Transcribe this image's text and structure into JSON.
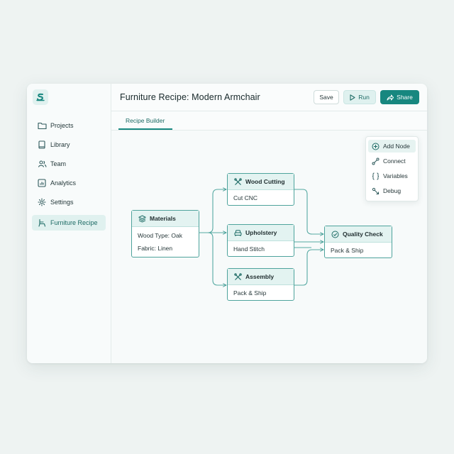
{
  "app": {
    "title": "Furniture Recipe: Modern Armchair"
  },
  "sidebar": {
    "items": [
      {
        "label": "Projects",
        "icon": "folder-icon"
      },
      {
        "label": "Library",
        "icon": "book-icon"
      },
      {
        "label": "Team",
        "icon": "team-icon"
      },
      {
        "label": "Analytics",
        "icon": "chart-icon"
      },
      {
        "label": "Settings",
        "icon": "gear-icon"
      },
      {
        "label": "Furniture Recipe",
        "icon": "chair-icon",
        "active": true
      }
    ]
  },
  "toolbar": {
    "save_label": "Save",
    "run_label": "Run",
    "share_label": "Share"
  },
  "tabs": [
    {
      "label": "Recipe Builder",
      "active": true
    }
  ],
  "menu": {
    "items": [
      {
        "label": "Add Node",
        "icon": "plus-circle-icon"
      },
      {
        "label": "Connect",
        "icon": "link-icon"
      },
      {
        "label": "Variables",
        "icon": "braces-icon"
      },
      {
        "label": "Debug",
        "icon": "bug-icon"
      }
    ]
  },
  "nodes": {
    "materials": {
      "title": "Materials",
      "rows": [
        "Wood Type: Oak",
        "Fabric: Linen"
      ],
      "icon": "layers-icon"
    },
    "wood_cutting": {
      "title": "Wood Cutting",
      "rows": [
        "Cut CNC"
      ],
      "icon": "tools-icon"
    },
    "upholstery": {
      "title": "Upholstery",
      "rows": [
        "Hand Stitch"
      ],
      "icon": "sofa-icon"
    },
    "assembly": {
      "title": "Assembly",
      "rows": [
        "Pack & Ship"
      ],
      "icon": "tools-icon"
    },
    "quality_check": {
      "title": "Quality Check",
      "rows": [
        "Pack & Ship"
      ],
      "icon": "check-circle-icon"
    }
  },
  "colors": {
    "accent": "#17877f",
    "accent_light": "#e0f1ef",
    "node_border": "#4ea39c"
  }
}
